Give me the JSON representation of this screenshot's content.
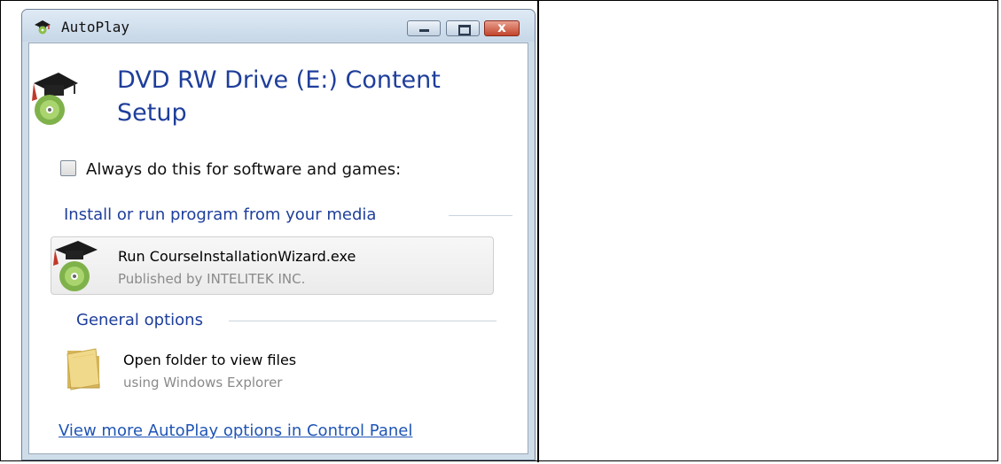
{
  "window": {
    "title": "AutoPlay",
    "icon": "autoplay-icon",
    "controls": {
      "minimize": "minimize-icon",
      "maximize": "maximize-icon",
      "close": "close-icon",
      "close_glyph": "x"
    }
  },
  "header": {
    "icon": "graduation-cap-disc-icon",
    "title": "DVD RW Drive (E:) Content Setup"
  },
  "always_checkbox": {
    "checked": false,
    "label": "Always do this for software and games:"
  },
  "sections": {
    "install": {
      "title": "Install or run program from your media"
    },
    "general": {
      "title": "General options"
    }
  },
  "options": {
    "run": {
      "icon": "graduation-cap-disc-icon",
      "title": "Run CourseInstallationWizard.exe",
      "subtitle": "Published by INTELITEK INC."
    },
    "folder": {
      "icon": "folder-icon",
      "title": "Open folder to view files",
      "subtitle": "using Windows Explorer"
    }
  },
  "link": {
    "label": "View more AutoPlay options in Control Panel"
  },
  "colors": {
    "heading": "#1e3e9b",
    "link": "#1f55b5",
    "close_button": "#c2452c"
  }
}
